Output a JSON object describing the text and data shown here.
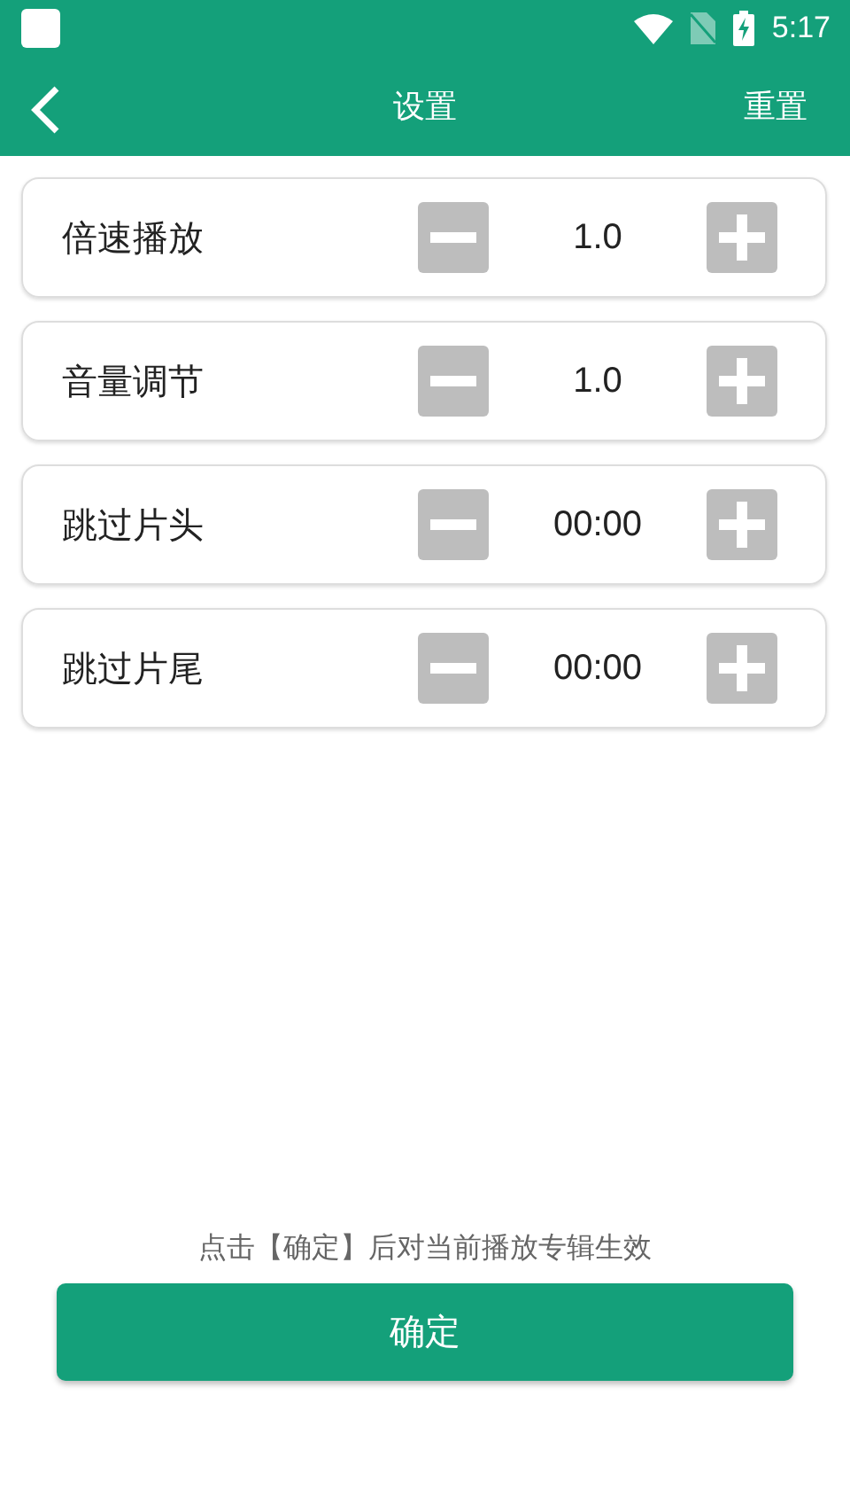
{
  "status_bar": {
    "time": "5:17"
  },
  "header": {
    "title": "设置",
    "action": "重置"
  },
  "settings": [
    {
      "label": "倍速播放",
      "value": "1.0"
    },
    {
      "label": "音量调节",
      "value": "1.0"
    },
    {
      "label": "跳过片头",
      "value": "00:00"
    },
    {
      "label": "跳过片尾",
      "value": "00:00"
    }
  ],
  "note": "点击【确定】后对当前播放专辑生效",
  "confirm_button": "确定"
}
